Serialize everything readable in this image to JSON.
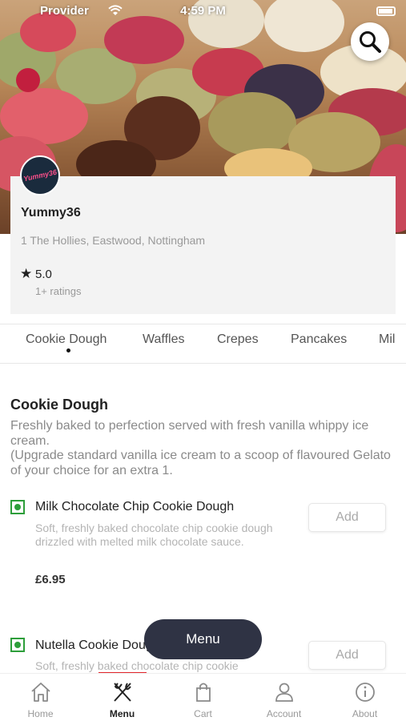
{
  "status_bar": {
    "carrier": "Provider",
    "time": "4:59 PM"
  },
  "shop": {
    "logo_text": "Yummy36",
    "name": "Yummy36",
    "address": "1 The Hollies, Eastwood, Nottingham",
    "rating": "5.0",
    "ratings_count": "1+ ratings"
  },
  "tabs": [
    {
      "label": "Cookie Dough",
      "active": true
    },
    {
      "label": "Waffles"
    },
    {
      "label": "Crepes"
    },
    {
      "label": "Pancakes"
    },
    {
      "label": "Mil"
    }
  ],
  "section": {
    "title": "Cookie Dough",
    "description_line1": "Freshly baked to perfection served with fresh vanilla whippy ice cream.",
    "description_line2": "(Upgrade standard vanilla ice cream to a scoop of flavoured Gelato of your choice for an extra 1."
  },
  "items": [
    {
      "name": "Milk Chocolate Chip Cookie Dough",
      "description": "Soft, freshly baked chocolate chip cookie dough drizzled with melted milk chocolate sauce.",
      "price": "£6.95",
      "add_label": "Add"
    },
    {
      "name": "Nutella Cookie Dough",
      "description": "Soft, freshly baked chocolate chip cookie",
      "add_label": "Add"
    }
  ],
  "floating_button": "Menu",
  "bottom_nav": [
    {
      "label": "Home",
      "icon": "home-icon"
    },
    {
      "label": "Menu",
      "icon": "utensils-icon",
      "active": true
    },
    {
      "label": "Cart",
      "icon": "bag-icon"
    },
    {
      "label": "Account",
      "icon": "user-icon"
    },
    {
      "label": "About",
      "icon": "info-icon"
    }
  ],
  "colors": {
    "accent": "#2d9e3a",
    "fab": "#2f3344",
    "underline": "#e3262c"
  }
}
